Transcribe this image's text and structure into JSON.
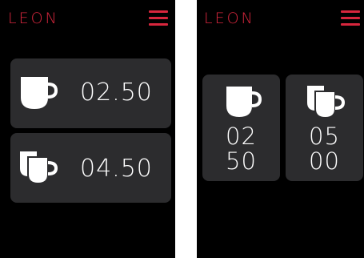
{
  "brand": {
    "logo_text": "LEON",
    "accent_color": "#d7263d",
    "menu_icon": "hamburger-menu-icon"
  },
  "left_screen": {
    "options": [
      {
        "icon": "single-cup-icon",
        "price": "02.50"
      },
      {
        "icon": "double-cup-icon",
        "price": "04.50"
      }
    ]
  },
  "right_screen": {
    "tiles": [
      {
        "icon": "single-cup-icon",
        "price_top": "02",
        "price_bottom": "50"
      },
      {
        "icon": "double-cup-icon",
        "price_top": "05",
        "price_bottom": "00"
      }
    ]
  },
  "colors": {
    "background": "#000000",
    "card": "#2c2c2e",
    "text": "#ffffff"
  }
}
